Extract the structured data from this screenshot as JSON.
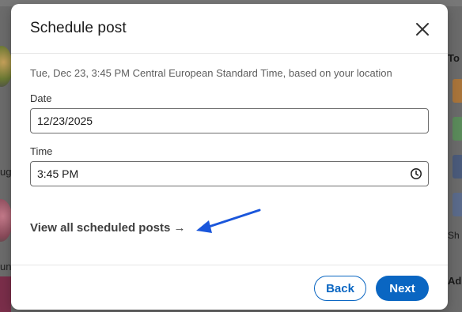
{
  "modal": {
    "title": "Schedule post",
    "location_note": "Tue, Dec 23, 3:45 PM Central European Standard Time, based on your location",
    "date": {
      "label": "Date",
      "value": "12/23/2025"
    },
    "time": {
      "label": "Time",
      "value": "3:45 PM"
    },
    "view_scheduled_link": "View all scheduled posts →",
    "back_label": "Back",
    "next_label": "Next"
  },
  "background": {
    "left_snippets": [
      "ug",
      "un"
    ],
    "right_snippets": [
      "To",
      "Sh",
      "Ad"
    ]
  },
  "colors": {
    "primary": "#0a66c2",
    "annotation_arrow": "#1a56db"
  },
  "icons": {
    "close": "close-icon",
    "clock": "clock-icon",
    "annotation": "arrow-annotation"
  }
}
